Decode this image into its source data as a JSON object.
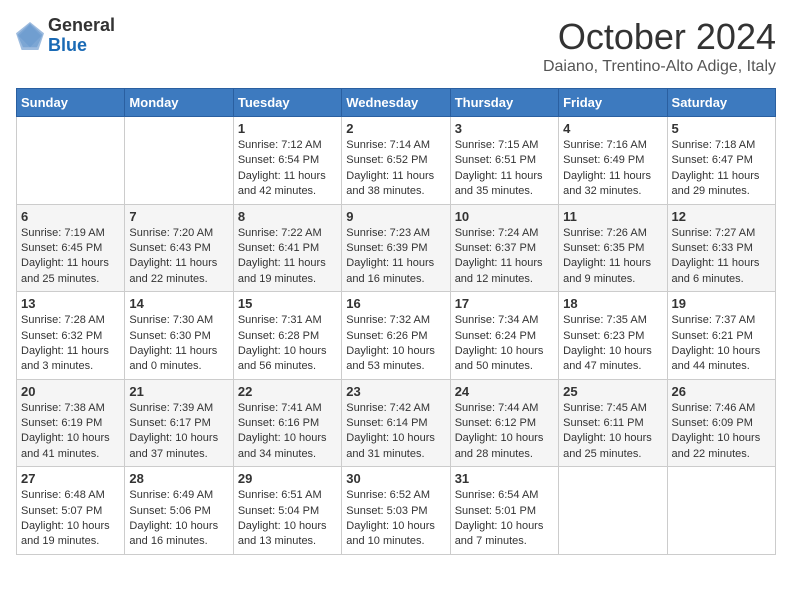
{
  "header": {
    "logo_general": "General",
    "logo_blue": "Blue",
    "month": "October 2024",
    "location": "Daiano, Trentino-Alto Adige, Italy"
  },
  "days_of_week": [
    "Sunday",
    "Monday",
    "Tuesday",
    "Wednesday",
    "Thursday",
    "Friday",
    "Saturday"
  ],
  "weeks": [
    [
      {
        "day": "",
        "sunrise": "",
        "sunset": "",
        "daylight": ""
      },
      {
        "day": "",
        "sunrise": "",
        "sunset": "",
        "daylight": ""
      },
      {
        "day": "1",
        "sunrise": "Sunrise: 7:12 AM",
        "sunset": "Sunset: 6:54 PM",
        "daylight": "Daylight: 11 hours and 42 minutes."
      },
      {
        "day": "2",
        "sunrise": "Sunrise: 7:14 AM",
        "sunset": "Sunset: 6:52 PM",
        "daylight": "Daylight: 11 hours and 38 minutes."
      },
      {
        "day": "3",
        "sunrise": "Sunrise: 7:15 AM",
        "sunset": "Sunset: 6:51 PM",
        "daylight": "Daylight: 11 hours and 35 minutes."
      },
      {
        "day": "4",
        "sunrise": "Sunrise: 7:16 AM",
        "sunset": "Sunset: 6:49 PM",
        "daylight": "Daylight: 11 hours and 32 minutes."
      },
      {
        "day": "5",
        "sunrise": "Sunrise: 7:18 AM",
        "sunset": "Sunset: 6:47 PM",
        "daylight": "Daylight: 11 hours and 29 minutes."
      }
    ],
    [
      {
        "day": "6",
        "sunrise": "Sunrise: 7:19 AM",
        "sunset": "Sunset: 6:45 PM",
        "daylight": "Daylight: 11 hours and 25 minutes."
      },
      {
        "day": "7",
        "sunrise": "Sunrise: 7:20 AM",
        "sunset": "Sunset: 6:43 PM",
        "daylight": "Daylight: 11 hours and 22 minutes."
      },
      {
        "day": "8",
        "sunrise": "Sunrise: 7:22 AM",
        "sunset": "Sunset: 6:41 PM",
        "daylight": "Daylight: 11 hours and 19 minutes."
      },
      {
        "day": "9",
        "sunrise": "Sunrise: 7:23 AM",
        "sunset": "Sunset: 6:39 PM",
        "daylight": "Daylight: 11 hours and 16 minutes."
      },
      {
        "day": "10",
        "sunrise": "Sunrise: 7:24 AM",
        "sunset": "Sunset: 6:37 PM",
        "daylight": "Daylight: 11 hours and 12 minutes."
      },
      {
        "day": "11",
        "sunrise": "Sunrise: 7:26 AM",
        "sunset": "Sunset: 6:35 PM",
        "daylight": "Daylight: 11 hours and 9 minutes."
      },
      {
        "day": "12",
        "sunrise": "Sunrise: 7:27 AM",
        "sunset": "Sunset: 6:33 PM",
        "daylight": "Daylight: 11 hours and 6 minutes."
      }
    ],
    [
      {
        "day": "13",
        "sunrise": "Sunrise: 7:28 AM",
        "sunset": "Sunset: 6:32 PM",
        "daylight": "Daylight: 11 hours and 3 minutes."
      },
      {
        "day": "14",
        "sunrise": "Sunrise: 7:30 AM",
        "sunset": "Sunset: 6:30 PM",
        "daylight": "Daylight: 11 hours and 0 minutes."
      },
      {
        "day": "15",
        "sunrise": "Sunrise: 7:31 AM",
        "sunset": "Sunset: 6:28 PM",
        "daylight": "Daylight: 10 hours and 56 minutes."
      },
      {
        "day": "16",
        "sunrise": "Sunrise: 7:32 AM",
        "sunset": "Sunset: 6:26 PM",
        "daylight": "Daylight: 10 hours and 53 minutes."
      },
      {
        "day": "17",
        "sunrise": "Sunrise: 7:34 AM",
        "sunset": "Sunset: 6:24 PM",
        "daylight": "Daylight: 10 hours and 50 minutes."
      },
      {
        "day": "18",
        "sunrise": "Sunrise: 7:35 AM",
        "sunset": "Sunset: 6:23 PM",
        "daylight": "Daylight: 10 hours and 47 minutes."
      },
      {
        "day": "19",
        "sunrise": "Sunrise: 7:37 AM",
        "sunset": "Sunset: 6:21 PM",
        "daylight": "Daylight: 10 hours and 44 minutes."
      }
    ],
    [
      {
        "day": "20",
        "sunrise": "Sunrise: 7:38 AM",
        "sunset": "Sunset: 6:19 PM",
        "daylight": "Daylight: 10 hours and 41 minutes."
      },
      {
        "day": "21",
        "sunrise": "Sunrise: 7:39 AM",
        "sunset": "Sunset: 6:17 PM",
        "daylight": "Daylight: 10 hours and 37 minutes."
      },
      {
        "day": "22",
        "sunrise": "Sunrise: 7:41 AM",
        "sunset": "Sunset: 6:16 PM",
        "daylight": "Daylight: 10 hours and 34 minutes."
      },
      {
        "day": "23",
        "sunrise": "Sunrise: 7:42 AM",
        "sunset": "Sunset: 6:14 PM",
        "daylight": "Daylight: 10 hours and 31 minutes."
      },
      {
        "day": "24",
        "sunrise": "Sunrise: 7:44 AM",
        "sunset": "Sunset: 6:12 PM",
        "daylight": "Daylight: 10 hours and 28 minutes."
      },
      {
        "day": "25",
        "sunrise": "Sunrise: 7:45 AM",
        "sunset": "Sunset: 6:11 PM",
        "daylight": "Daylight: 10 hours and 25 minutes."
      },
      {
        "day": "26",
        "sunrise": "Sunrise: 7:46 AM",
        "sunset": "Sunset: 6:09 PM",
        "daylight": "Daylight: 10 hours and 22 minutes."
      }
    ],
    [
      {
        "day": "27",
        "sunrise": "Sunrise: 6:48 AM",
        "sunset": "Sunset: 5:07 PM",
        "daylight": "Daylight: 10 hours and 19 minutes."
      },
      {
        "day": "28",
        "sunrise": "Sunrise: 6:49 AM",
        "sunset": "Sunset: 5:06 PM",
        "daylight": "Daylight: 10 hours and 16 minutes."
      },
      {
        "day": "29",
        "sunrise": "Sunrise: 6:51 AM",
        "sunset": "Sunset: 5:04 PM",
        "daylight": "Daylight: 10 hours and 13 minutes."
      },
      {
        "day": "30",
        "sunrise": "Sunrise: 6:52 AM",
        "sunset": "Sunset: 5:03 PM",
        "daylight": "Daylight: 10 hours and 10 minutes."
      },
      {
        "day": "31",
        "sunrise": "Sunrise: 6:54 AM",
        "sunset": "Sunset: 5:01 PM",
        "daylight": "Daylight: 10 hours and 7 minutes."
      },
      {
        "day": "",
        "sunrise": "",
        "sunset": "",
        "daylight": ""
      },
      {
        "day": "",
        "sunrise": "",
        "sunset": "",
        "daylight": ""
      }
    ]
  ]
}
